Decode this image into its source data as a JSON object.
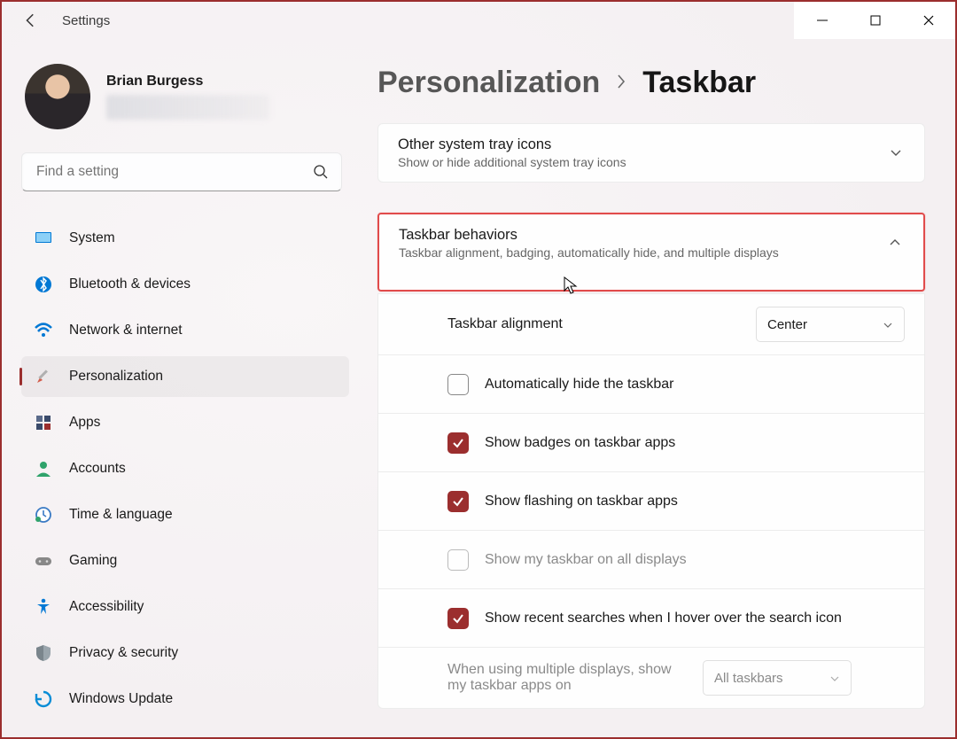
{
  "app": {
    "title": "Settings"
  },
  "user": {
    "name": "Brian Burgess"
  },
  "search": {
    "placeholder": "Find a setting"
  },
  "nav": [
    {
      "label": "System"
    },
    {
      "label": "Bluetooth & devices"
    },
    {
      "label": "Network & internet"
    },
    {
      "label": "Personalization"
    },
    {
      "label": "Apps"
    },
    {
      "label": "Accounts"
    },
    {
      "label": "Time & language"
    },
    {
      "label": "Gaming"
    },
    {
      "label": "Accessibility"
    },
    {
      "label": "Privacy & security"
    },
    {
      "label": "Windows Update"
    }
  ],
  "breadcrumb": {
    "a": "Personalization",
    "b": "Taskbar"
  },
  "cards": {
    "other": {
      "title": "Other system tray icons",
      "sub": "Show or hide additional system tray icons"
    },
    "behaviors": {
      "title": "Taskbar behaviors",
      "sub": "Taskbar alignment, badging, automatically hide, and multiple displays"
    }
  },
  "opts": {
    "alignment_label": "Taskbar alignment",
    "alignment_value": "Center",
    "autohide": "Automatically hide the taskbar",
    "badges": "Show badges on taskbar apps",
    "flashing": "Show flashing on taskbar apps",
    "alldisplays": "Show my taskbar on all displays",
    "recent": "Show recent searches when I hover over the search icon",
    "multi_label": "When using multiple displays, show my taskbar apps on",
    "multi_value": "All taskbars"
  }
}
